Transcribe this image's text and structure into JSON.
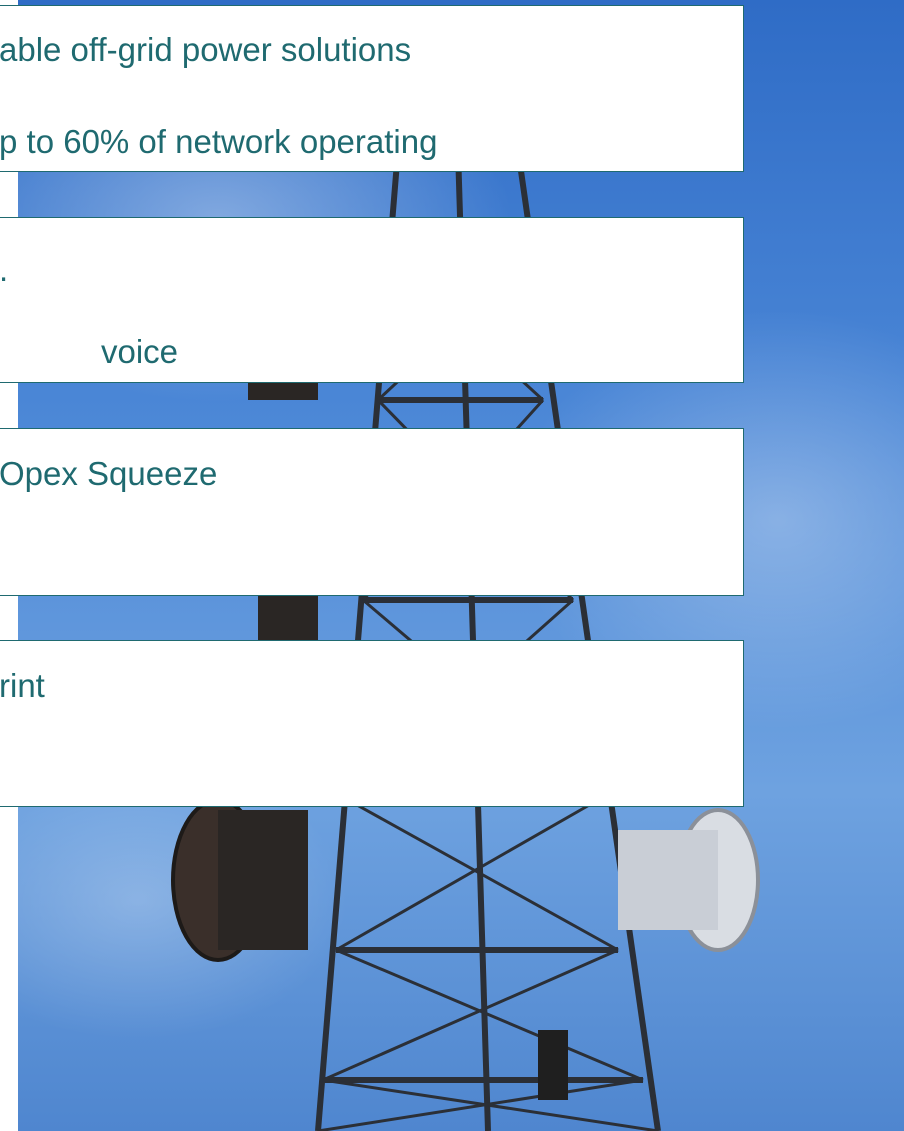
{
  "boxes": [
    {
      "lines": [
        "able off-grid power solutions",
        "p to 60% of network operating"
      ]
    },
    {
      "lines": [
        ".",
        "voice"
      ]
    },
    {
      "lines": [
        "Opex Squeeze"
      ]
    },
    {
      "lines": [
        "rint"
      ]
    }
  ],
  "colors": {
    "text": "#1f6a70",
    "border": "#1f6a70",
    "sky": "#4a86d6",
    "tower": "#2b2f36"
  },
  "background_image": "telecom-tower-against-blue-sky"
}
